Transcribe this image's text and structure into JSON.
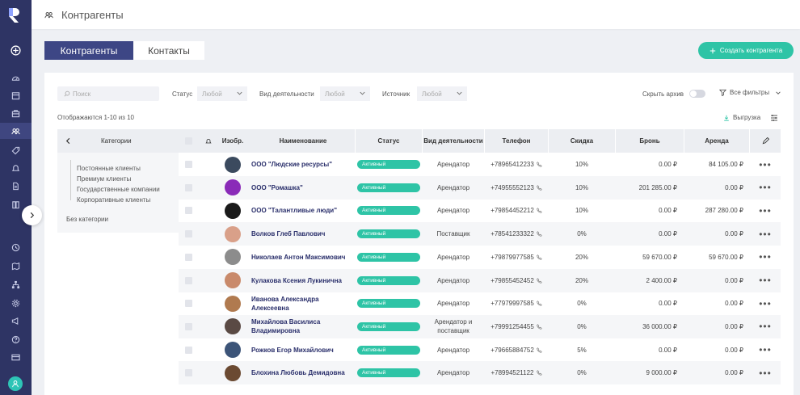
{
  "topbar": {
    "title": "Контрагенты"
  },
  "tabs": [
    {
      "label": "Контрагенты",
      "active": true
    },
    {
      "label": "Контакты",
      "active": false
    }
  ],
  "create_button": "Создать контрагента",
  "filters": {
    "search_placeholder": "Поиск",
    "status_label": "Статус",
    "status_value": "Любой",
    "activity_label": "Вид деятельности",
    "activity_value": "Любой",
    "source_label": "Источник",
    "source_value": "Любой",
    "hide_archive": "Скрыть архив",
    "all_filters": "Все фильтры"
  },
  "count_text": "Отображаются 1-10 из 10",
  "export_label": "Выгрузка",
  "categories": {
    "title": "Категории",
    "items": [
      "Постоянные клиенты",
      "Премиум клиенты",
      "Государственные компании",
      "Корпоративные клиенты"
    ],
    "uncategorized": "Без категории"
  },
  "table": {
    "headers": {
      "image": "Изобр.",
      "name": "Наименование",
      "status": "Статус",
      "activity": "Вид деятельности",
      "phone": "Телефон",
      "discount": "Скидка",
      "booking": "Бронь",
      "rent": "Аренда"
    },
    "rows": [
      {
        "name": "ООО \"Людские ресурсы\"",
        "status": "Активный",
        "activity": "Арендатор",
        "phone": "+78965412233",
        "discount": "10%",
        "booking": "0.00 ₽",
        "rent": "84 105.00 ₽",
        "avatar_color": "#3b4a5e"
      },
      {
        "name": "ООО \"Ромашка\"",
        "status": "Активный",
        "activity": "Арендатор",
        "phone": "+74955552123",
        "discount": "10%",
        "booking": "201 285.00 ₽",
        "rent": "0.00 ₽",
        "avatar_color": "#8a2bb8"
      },
      {
        "name": "ООО \"Талантливые люди\"",
        "status": "Активный",
        "activity": "Арендатор",
        "phone": "+79854452212",
        "discount": "10%",
        "booking": "0.00 ₽",
        "rent": "287 280.00 ₽",
        "avatar_color": "#1a1a1a"
      },
      {
        "name": "Волков Глеб Павлович",
        "status": "Активный",
        "activity": "Поставщик",
        "phone": "+78541233322",
        "discount": "0%",
        "booking": "0.00 ₽",
        "rent": "0.00 ₽",
        "avatar_color": "#d9a089"
      },
      {
        "name": "Николаев Антон Максимович",
        "status": "Активный",
        "activity": "Арендатор",
        "phone": "+79879977585",
        "discount": "20%",
        "booking": "59 670.00 ₽",
        "rent": "59 670.00 ₽",
        "avatar_color": "#8c8c8c"
      },
      {
        "name": "Кулакова Ксения Лукинична",
        "status": "Активный",
        "activity": "Арендатор",
        "phone": "+79855452452",
        "discount": "20%",
        "booking": "2 400.00 ₽",
        "rent": "0.00 ₽",
        "avatar_color": "#c98a6b"
      },
      {
        "name": "Иванова Александра Алексеевна",
        "status": "Активный",
        "activity": "Арендатор",
        "phone": "+77979997585",
        "discount": "0%",
        "booking": "0.00 ₽",
        "rent": "0.00 ₽",
        "avatar_color": "#b07a4f"
      },
      {
        "name": "Михайлова Василиса Владимировна",
        "status": "Активный",
        "activity": "Арендатор и поставщик",
        "phone": "+79991254455",
        "discount": "0%",
        "booking": "36 000.00 ₽",
        "rent": "0.00 ₽",
        "avatar_color": "#5a4a44"
      },
      {
        "name": "Рожков Егор Михайлович",
        "status": "Активный",
        "activity": "Арендатор",
        "phone": "+79665884752",
        "discount": "5%",
        "booking": "0.00 ₽",
        "rent": "0.00 ₽",
        "avatar_color": "#3c5478"
      },
      {
        "name": "Блохина Любовь Демидовна",
        "status": "Активный",
        "activity": "Арендатор",
        "phone": "+78994521122",
        "discount": "0%",
        "booking": "9 000.00 ₽",
        "rent": "0.00 ₽",
        "avatar_color": "#6b4a32"
      }
    ]
  },
  "colors": {
    "sidebar": "#2e3464",
    "accent_green": "#2ec4a6",
    "tab_active": "#3d4685",
    "name_link": "#2a2f6b"
  },
  "icons": {
    "sidebar": [
      "plus-circle-icon",
      "dashboard-icon",
      "calendar-icon",
      "briefcase-icon",
      "contacts-icon",
      "tag-icon",
      "bell-icon",
      "document-icon",
      "book-icon",
      "history-icon",
      "map-icon",
      "structure-icon",
      "gear-icon",
      "megaphone-icon",
      "help-icon",
      "card-icon",
      "user-icon"
    ]
  }
}
